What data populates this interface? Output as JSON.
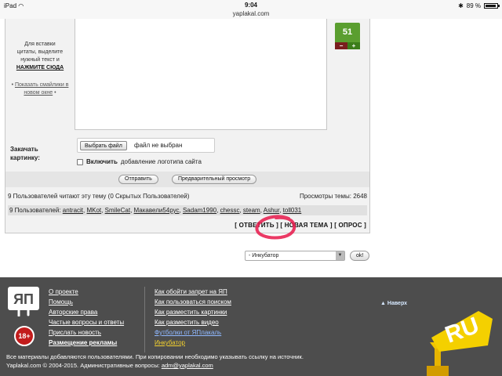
{
  "status_bar": {
    "device": "iPad",
    "time": "9:04",
    "url": "yaplakal.com",
    "battery": "89 %"
  },
  "post_form": {
    "quote_hint_line1": "Для вставки",
    "quote_hint_line2": "цитаты, выделите",
    "quote_hint_line3": "нужный текст и",
    "quote_hint_action": "НАЖМИТЕ СЮДА",
    "smiles_link": "Показать смайлики в новом окне",
    "rating": "51",
    "rating_minus": "−",
    "rating_plus": "+",
    "upload_label_line1": "Закачать",
    "upload_label_line2": "картинку:",
    "file_button": "Выбрать файл",
    "file_status": "файл не выбран",
    "logo_bold": "Включить",
    "logo_text": "добавление логотипа сайта",
    "send_button": "Отправить",
    "preview_button": "Предварительный просмотр"
  },
  "topic_info": {
    "readers": "9 Пользователей читают эту тему (0 Скрытых Пользователей)",
    "views_label": "Просмотры темы:",
    "views": "2648",
    "users_prefix": "9 Пользователей:",
    "users": [
      "antracit",
      "MKot",
      "SmileCat",
      "Макавели54рус",
      "Sadam1990",
      "chessc",
      "steam",
      "Ashur",
      "toll031"
    ]
  },
  "actions": {
    "reply": "[ ОТВЕТИТЬ ]",
    "new_topic": "[ НОВАЯ ТЕМА ]",
    "poll": "[ ОПРОС ]"
  },
  "forum_jump": {
    "selected": "- Инкубатор",
    "ok": "ok!"
  },
  "footer": {
    "col1": [
      "О проекте",
      "Помощь",
      "Авторские права",
      "Частые вопросы и ответы",
      "Прислать новость",
      "Размещение рекламы"
    ],
    "col2": [
      "Как обойти запрет на ЯП",
      "Как пользоваться поиском",
      "Как разместить картинки",
      "Как разместить видео",
      "Футболки от ЯПлакаль",
      "Инкубатор"
    ],
    "top_link": "Наверх",
    "age": "18+",
    "logo_text": "ЯП",
    "ru_text": "RU",
    "copyright_line1": "Все материалы добавляются пользователями. При копировании необходимо указывать ссылку на источник.",
    "copyright_line2": "Yaplakal.com © 2004-2015. Административные вопросы:",
    "admin_email": "adm@yaplakal.com"
  },
  "colors": {
    "rating_green": "#5a9e2f",
    "footer_bg": "#4d4d4d",
    "highlight_circle": "#e8174a",
    "footer_link_yellow": "#f5d22e"
  }
}
